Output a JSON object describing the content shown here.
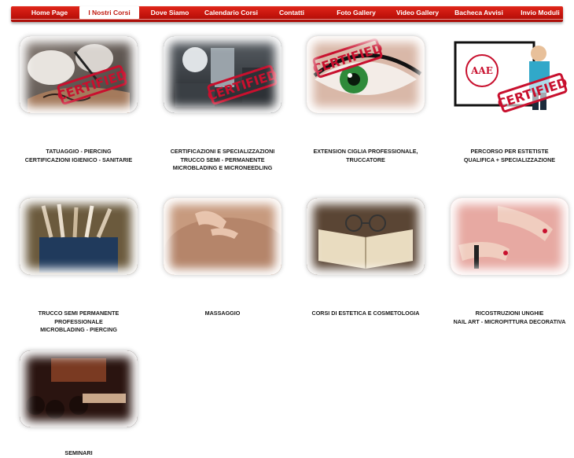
{
  "nav": {
    "items": [
      {
        "label": "Home Page",
        "active": false
      },
      {
        "label": "I Nostri Corsi",
        "active": true
      },
      {
        "label": "Dove Siamo",
        "active": false
      },
      {
        "label": "Calendario Corsi",
        "active": false
      },
      {
        "label": "Contatti",
        "active": false
      },
      {
        "label": "Foto Gallery",
        "active": false
      },
      {
        "label": "Video Gallery",
        "active": false
      },
      {
        "label": "Bacheca Avvisi",
        "active": false
      },
      {
        "label": "Invio Moduli",
        "active": false
      }
    ]
  },
  "courses": [
    {
      "lines": [
        "TATUAGGIO - PIERCING",
        "CERTIFICAZIONI IGIENICO - SANITARIE"
      ],
      "stamp": "CERTIFIED"
    },
    {
      "lines": [
        "CERTIFICAZIONI E SPECIALIZZAZIONI",
        "TRUCCO SEMI - PERMANENTE",
        "MICROBLADING E MICRONEEDLING"
      ],
      "stamp": "CERTIFIED"
    },
    {
      "lines": [
        "EXTENSION CIGLIA PROFESSIONALE,",
        "TRUCCATORE"
      ],
      "stamp": "CERTIFIED"
    },
    {
      "lines": [
        "PERCORSO PER ESTETISTE",
        "QUALIFICA + SPECIALIZZAZIONE"
      ],
      "stamp": "CERTIFIED",
      "logo": "AAE"
    },
    {
      "lines": [
        "TRUCCO SEMI PERMANENTE",
        "PROFESSIONALE",
        "MICROBLADING - PIERCING"
      ]
    },
    {
      "lines": [
        "MASSAGGIO"
      ]
    },
    {
      "lines": [
        "CORSI DI ESTETICA E COSMETOLOGIA"
      ]
    },
    {
      "lines": [
        "RICOSTRUZIONI UNGHIE",
        "NAIL  ART  - MICROPITTURA DECORATIVA"
      ]
    },
    {
      "lines": [
        "SEMINARI"
      ]
    }
  ],
  "colors": {
    "nav_bg": "#c4140c",
    "stamp": "#c8102e"
  }
}
